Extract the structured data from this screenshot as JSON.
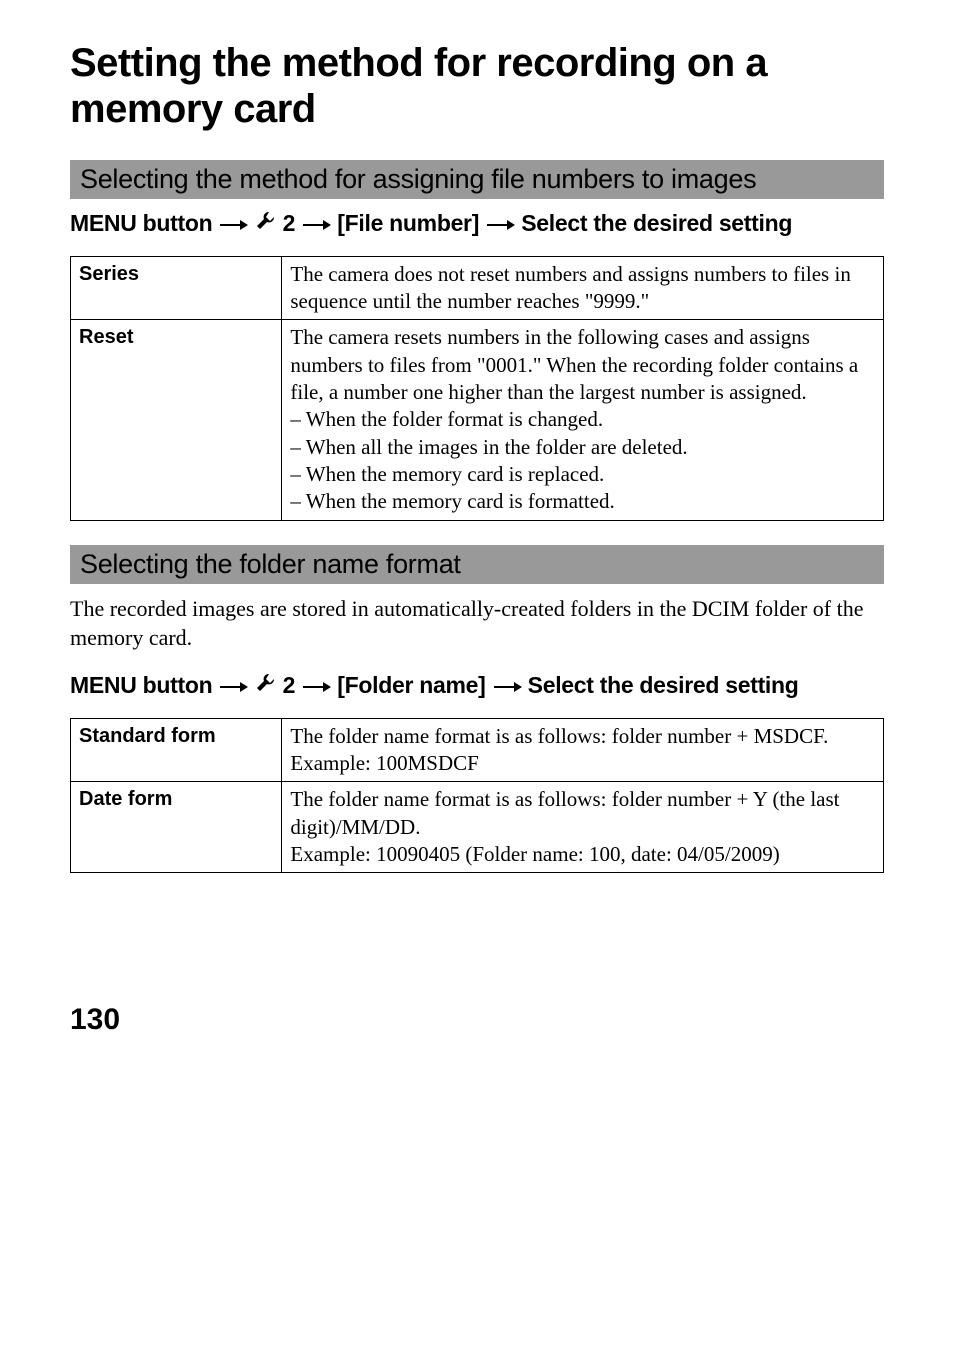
{
  "title": "Setting the method for recording on a memory card",
  "section1": {
    "header": "Selecting the method for assigning file numbers to images",
    "menu_prefix": "MENU button",
    "menu_num": " 2",
    "menu_item": "[File number]",
    "menu_suffix": "Select the desired setting",
    "table": {
      "row1": {
        "label": "Series",
        "desc": "The camera does not reset numbers and assigns numbers to files in sequence until the number reaches \"9999.\""
      },
      "row2": {
        "label": "Reset",
        "desc_p1": "The camera resets numbers in the following cases and assigns numbers to files from \"0001.\" When the recording folder contains a file, a number one higher than the largest number is assigned.",
        "desc_l1": "– When the folder format is changed.",
        "desc_l2": "– When all the images in the folder are deleted.",
        "desc_l3": "– When the memory card is replaced.",
        "desc_l4": "– When the memory card is formatted."
      }
    }
  },
  "section2": {
    "header": "Selecting the folder name format",
    "body": "The recorded images are stored in automatically-created folders in the DCIM folder of the memory card.",
    "menu_prefix": "MENU button",
    "menu_num": " 2",
    "menu_item": "[Folder name]",
    "menu_suffix": "Select the desired setting",
    "table": {
      "row1": {
        "label": "Standard form",
        "desc_p1": "The folder name format is as follows: folder number + MSDCF.",
        "desc_p2": "Example: 100MSDCF"
      },
      "row2": {
        "label": "Date form",
        "desc_p1": "The folder name format is as follows: folder number + Y (the last digit)/MM/DD.",
        "desc_p2": "Example: 10090405 (Folder name: 100, date: 04/05/2009)"
      }
    }
  },
  "page_number": "130"
}
